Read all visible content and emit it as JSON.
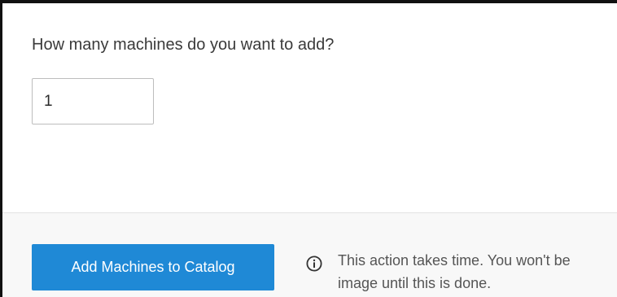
{
  "form": {
    "question": "How many machines do you want to add?",
    "machine_count_value": "1"
  },
  "footer": {
    "add_button_label": "Add Machines to Catalog",
    "info_icon": "info-circle-icon",
    "info_line_1": "This action takes time. You won't be",
    "info_line_2": "image until this is done."
  },
  "colors": {
    "primary_button": "#1f89d6",
    "footer_background": "#f8f8f8",
    "frame_border": "#111111"
  }
}
